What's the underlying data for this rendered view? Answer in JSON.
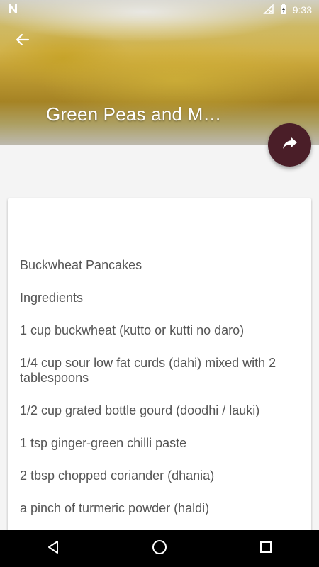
{
  "status_bar": {
    "time": "9:33",
    "icons": [
      "notification-n-icon",
      "no-signal-icon",
      "battery-charging-icon"
    ]
  },
  "header": {
    "title": "Green Peas and M…",
    "back_icon": "arrow-left-icon",
    "share_icon": "share-arrow-icon",
    "accent_color": "#4a1e28"
  },
  "recipe": {
    "lines": [
      "Buckwheat Pancakes",
      "Ingredients",
      "1 cup buckwheat (kutto or kutti no daro)",
      "1/4 cup sour low fat curds (dahi) mixed with 2 tablespoons",
      "1/2 cup grated bottle gourd (doodhi / lauki)",
      "1 tsp ginger-green chilli paste",
      "2 tbsp chopped coriander (dhania)",
      "a pinch of turmeric powder (haldi)"
    ]
  },
  "nav": {
    "buttons": [
      "back-triangle-icon",
      "home-circle-icon",
      "recents-square-icon"
    ]
  }
}
